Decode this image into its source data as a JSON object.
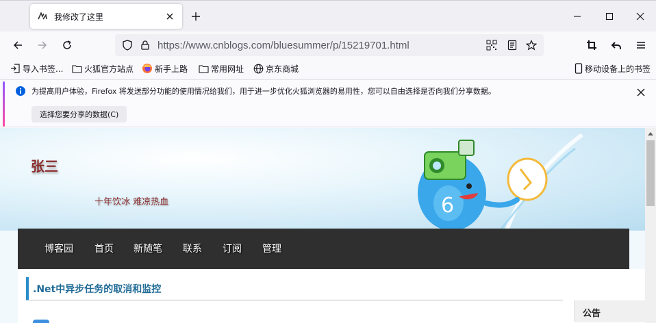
{
  "tab": {
    "title": "我修改了这里"
  },
  "urlbar": {
    "url_host": "https://www.cnblogs.com",
    "url_path": "/bluesummer/p/15219701.html"
  },
  "bookmarks": {
    "items": [
      {
        "label": "导入书签...",
        "icon": "import-icon"
      },
      {
        "label": "火狐官方站点",
        "icon": "folder-icon"
      },
      {
        "label": "新手上路",
        "icon": "firefox-icon"
      },
      {
        "label": "常用网址",
        "icon": "folder-icon"
      },
      {
        "label": "京东商城",
        "icon": "globe-icon"
      }
    ],
    "mobile": "移动设备上的书签"
  },
  "notification": {
    "message": "为提高用户体验，Firefox 将发送部分功能的使用情况给我们，用于进一步优化火狐浏览器的易用性，您可以自由选择是否向我们分享数据。",
    "button": "选择您要分享的数据(C)"
  },
  "page": {
    "blog_title": "张三",
    "subtitle": "十年饮冰 难凉热血",
    "menu": [
      "博客园",
      "首页",
      "新随笔",
      "联系",
      "订阅",
      "管理"
    ],
    "post_title": ".Net中异步任务的取消和监控",
    "sidebar_heading": "公告"
  },
  "colors": {
    "accent": "#2a8ec8",
    "menu_bg": "#2f2f2f",
    "title_red": "#8b2c2c"
  }
}
